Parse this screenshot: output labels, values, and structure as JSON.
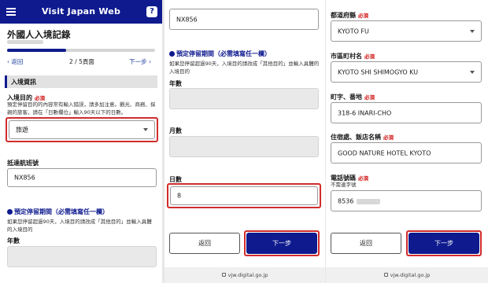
{
  "header": {
    "title": "Visit Japan Web",
    "help": "?"
  },
  "panel1": {
    "page_title": "外國人入境記錄",
    "nav_back": "‹ 返回",
    "step": "2 / 5頁面",
    "nav_next": "下一步 ›",
    "progress": 0.4,
    "section_title": "入境資訊",
    "purpose_label": "入境目的",
    "required": "必須",
    "purpose_help": "預定停留目的的內容常有輸入錯誤，請多加注意。觀光、商務、探親的旅客，請在「日數欄位」輸入90天以下的日數。",
    "purpose_value": "旅遊",
    "flight_label": "抵達航班號",
    "flight_value": "NX856",
    "stay_heading": "預定停留期間（必需填寫任一欄）",
    "stay_help": "如果您停留超過90天，入境目的請改成「其他目的」並輸入具體的入境目的",
    "years_label": "年數"
  },
  "panel2": {
    "flight_value": "NX856",
    "stay_heading": "預定停留期間（必需填寫任一欄）",
    "stay_help": "如果您停留超過90天，入境目的請改成「其他目的」並輸入具體的入境目的",
    "years_label": "年數",
    "months_label": "月數",
    "days_label": "日數",
    "days_value": "8",
    "back_button": "返回",
    "next_button": "下一步",
    "url": "vjw.digital.go.jp"
  },
  "panel3": {
    "prefecture_label": "都道府縣",
    "prefecture_value": "KYOTO FU",
    "city_label": "市區町村名",
    "city_value": "KYOTO SHI SHIMOGYO KU",
    "street_label": "町字、番地",
    "street_value": "318-6 INARI-CHO",
    "hotel_label": "住宿處、飯店名稱",
    "hotel_value": "GOOD NATURE HOTEL KYOTO",
    "phone_label": "電話號碼",
    "phone_hint": "不需連字號",
    "phone_value": "8536",
    "required": "必須",
    "back_button": "返回",
    "next_button": "下一步",
    "url": "vjw.digital.go.jp"
  },
  "colors": {
    "brand": "#0e1a8e",
    "required": "#d01010",
    "highlight": "#d12c2c"
  }
}
